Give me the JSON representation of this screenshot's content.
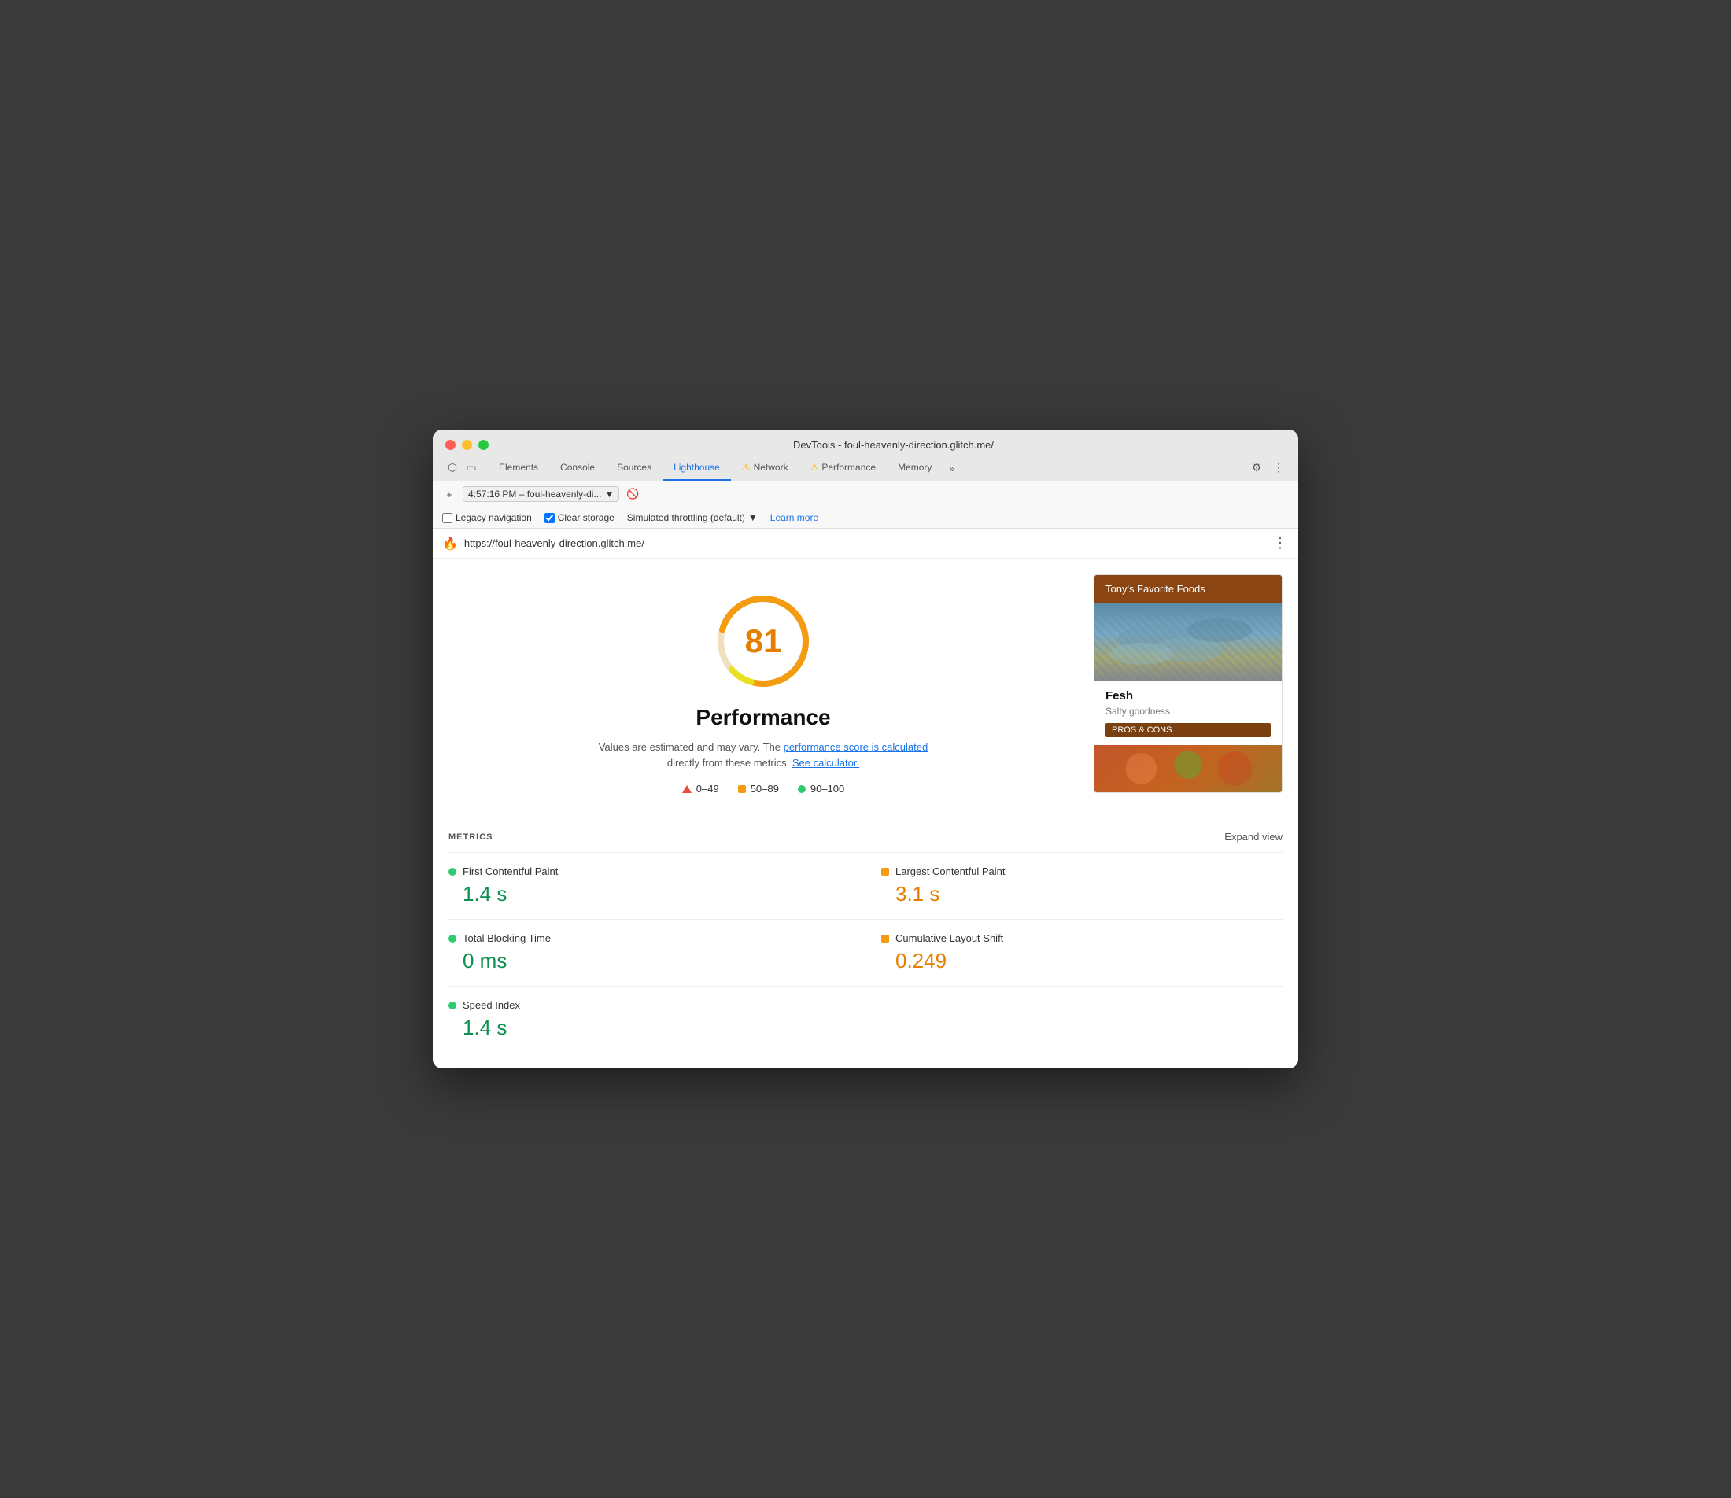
{
  "window": {
    "title": "DevTools - foul-heavenly-direction.glitch.me/"
  },
  "tabs": {
    "items": [
      {
        "label": "Elements",
        "active": false,
        "warning": false
      },
      {
        "label": "Console",
        "active": false,
        "warning": false
      },
      {
        "label": "Sources",
        "active": false,
        "warning": false
      },
      {
        "label": "Lighthouse",
        "active": true,
        "warning": false
      },
      {
        "label": "Network",
        "active": false,
        "warning": true
      },
      {
        "label": "Performance",
        "active": false,
        "warning": true
      },
      {
        "label": "Memory",
        "active": false,
        "warning": false
      }
    ],
    "overflow": "»"
  },
  "toolbar": {
    "time_select": "4:57:16 PM – foul-heavenly-di...",
    "reload_icon": "⟳"
  },
  "options": {
    "legacy_nav_label": "Legacy navigation",
    "clear_storage_label": "Clear storage",
    "throttle_label": "Simulated throttling (default)",
    "learn_more_label": "Learn more"
  },
  "url_bar": {
    "url": "https://foul-heavenly-direction.glitch.me/",
    "menu_dots": "⋮"
  },
  "score": {
    "value": "81",
    "title": "Performance",
    "description_start": "Values are estimated and may vary. The",
    "perf_link": "performance score is calculated",
    "description_mid": " directly from these metrics.",
    "calc_link": "See calculator.",
    "legend": [
      {
        "range": "0–49",
        "type": "triangle",
        "color": "#e74c3c"
      },
      {
        "range": "50–89",
        "type": "square",
        "color": "#f39c12"
      },
      {
        "range": "90–100",
        "type": "dot",
        "color": "#2ecc71"
      }
    ]
  },
  "preview": {
    "header": "Tony's Favorite Foods",
    "food_title": "Fesh",
    "food_subtitle": "Salty goodness",
    "btn_label": "PROS & CONS"
  },
  "metrics": {
    "section_label": "METRICS",
    "expand_label": "Expand view",
    "items": [
      {
        "label": "First Contentful Paint",
        "value": "1.4 s",
        "color": "green",
        "indicator_color": "#2ecc71",
        "indicator_type": "dot"
      },
      {
        "label": "Largest Contentful Paint",
        "value": "3.1 s",
        "color": "orange",
        "indicator_color": "#f39c12",
        "indicator_type": "square"
      },
      {
        "label": "Total Blocking Time",
        "value": "0 ms",
        "color": "green",
        "indicator_color": "#2ecc71",
        "indicator_type": "dot"
      },
      {
        "label": "Cumulative Layout Shift",
        "value": "0.249",
        "color": "orange",
        "indicator_color": "#f39c12",
        "indicator_type": "square"
      },
      {
        "label": "Speed Index",
        "value": "1.4 s",
        "color": "green",
        "indicator_color": "#2ecc71",
        "indicator_type": "dot"
      }
    ]
  }
}
